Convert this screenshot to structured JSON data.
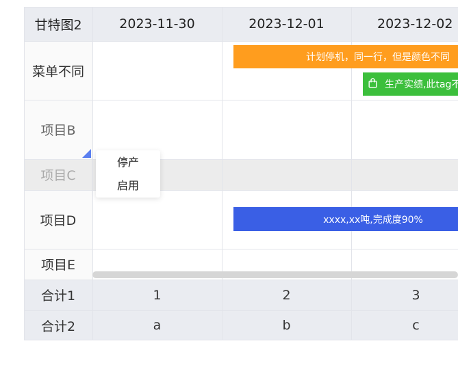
{
  "gantt": {
    "corner_label": "甘特图2",
    "dates": [
      "2023-11-30",
      "2023-12-01",
      "2023-12-02"
    ],
    "rows": [
      {
        "label": "菜单不同"
      },
      {
        "label": "项目B"
      },
      {
        "label": "项目C"
      },
      {
        "label": "项目D"
      },
      {
        "label": "项目E"
      }
    ],
    "tasks": {
      "orange": {
        "text": "计划停机，同一行，但是颜色不同",
        "color": "#ff9d1e"
      },
      "green": {
        "text": "生产实绩,此tag不",
        "color": "#3cbf3c",
        "icon": "shopping-bag-icon"
      },
      "blue": {
        "text": "xxxx,xx吨,完成度90%",
        "color": "#3a5fe5"
      }
    },
    "totals": [
      {
        "label": "合计1",
        "values": [
          "1",
          "2",
          "3"
        ]
      },
      {
        "label": "合计2",
        "values": [
          "a",
          "b",
          "c"
        ]
      }
    ]
  },
  "context_menu": {
    "items": [
      "停产",
      "启用"
    ]
  },
  "colors": {
    "header_bg": "#eaecf1",
    "disabled_row_bg": "#ececec",
    "accent": "#5b7ff0",
    "scrollbar": "#d6d6d6"
  }
}
